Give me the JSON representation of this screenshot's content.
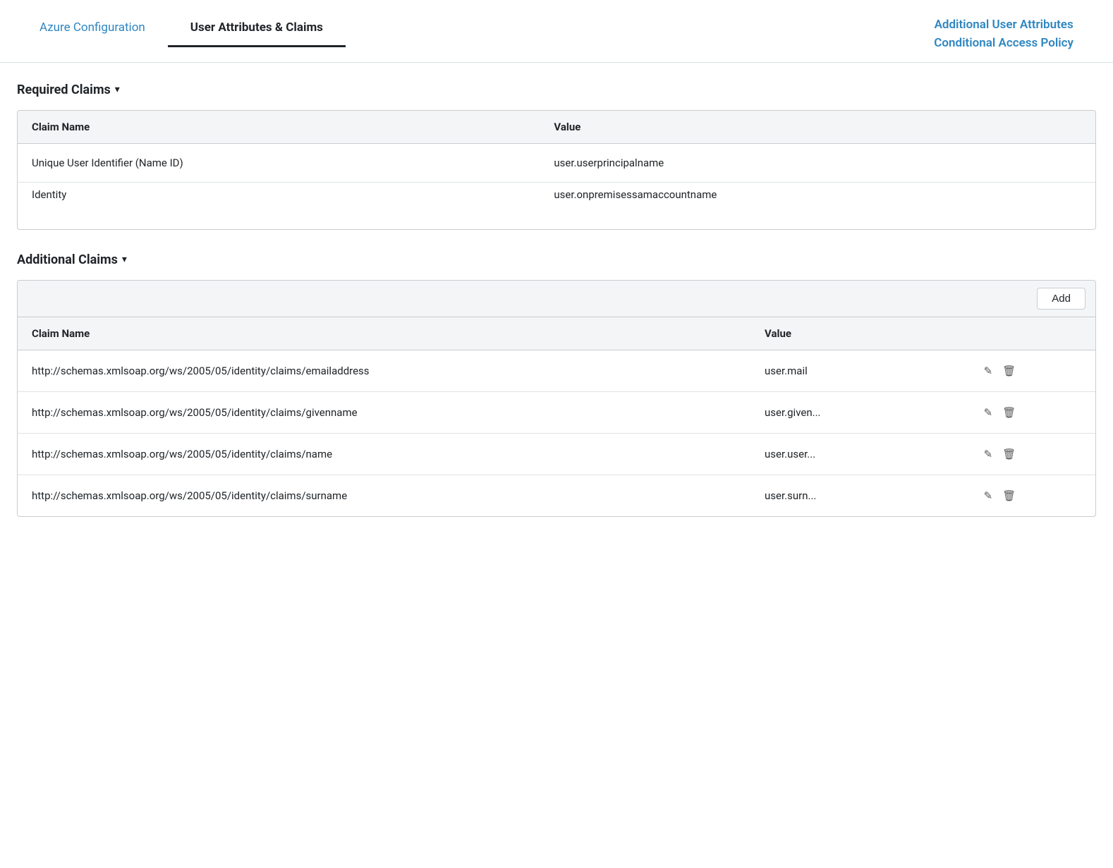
{
  "nav": {
    "tab_azure": "Azure Configuration",
    "tab_user_attrs": "User Attributes & Claims",
    "tab_additional": "Additional User Attributes",
    "tab_conditional": "Conditional Access Policy"
  },
  "required_claims": {
    "section_title": "Required Claims",
    "col_claim_name": "Claim Name",
    "col_value": "Value",
    "rows": [
      {
        "claim_name": "Unique User Identifier (Name ID)",
        "value": "user.userprincipalname"
      },
      {
        "claim_name": "Identity",
        "value": "user.onpremisessamaccountname"
      }
    ]
  },
  "additional_claims": {
    "section_title": "Additional Claims",
    "add_btn_label": "Add",
    "col_claim_name": "Claim Name",
    "col_value": "Value",
    "rows": [
      {
        "claim_name": "http://schemas.xmlsoap.org/ws/2005/05/identity/claims/emailaddress",
        "value": "user.mail"
      },
      {
        "claim_name": "http://schemas.xmlsoap.org/ws/2005/05/identity/claims/givenname",
        "value": "user.given..."
      },
      {
        "claim_name": "http://schemas.xmlsoap.org/ws/2005/05/identity/claims/name",
        "value": "user.user..."
      },
      {
        "claim_name": "http://schemas.xmlsoap.org/ws/2005/05/identity/claims/surname",
        "value": "user.surn..."
      }
    ]
  },
  "icons": {
    "chevron_down": "▾",
    "edit": "✎",
    "delete": "🗑"
  }
}
